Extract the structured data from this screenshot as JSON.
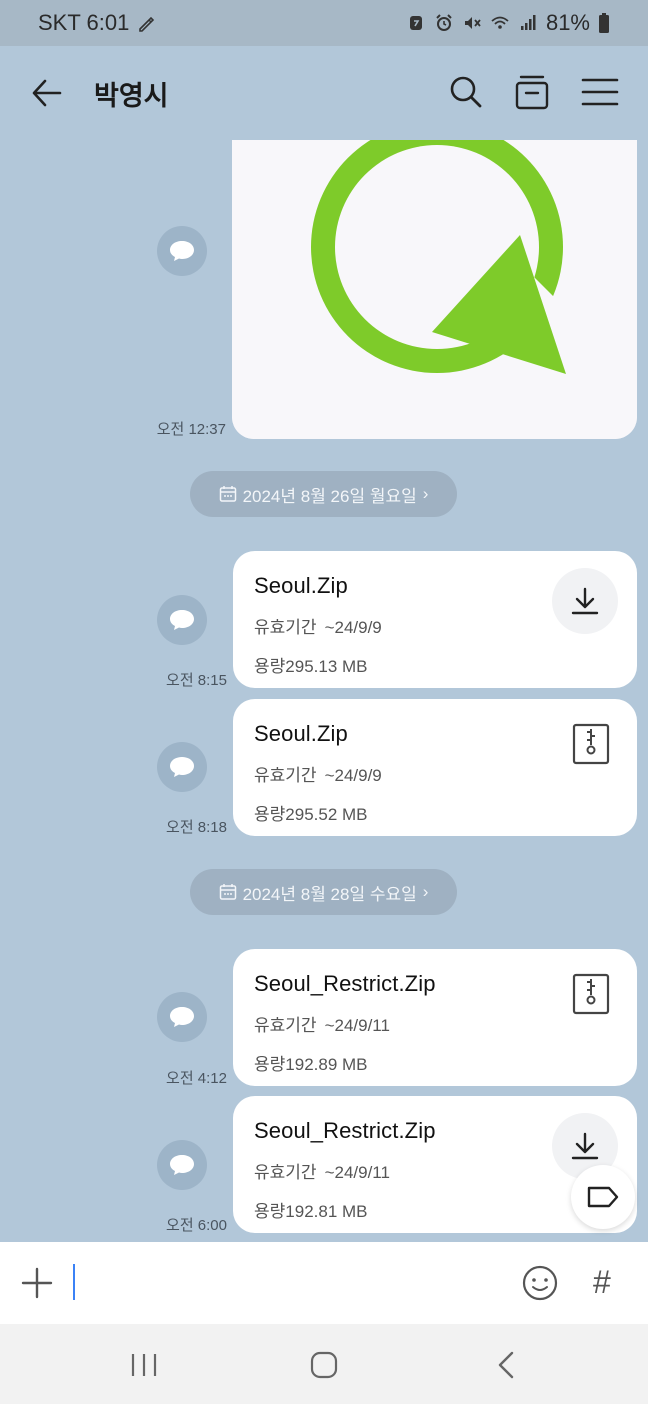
{
  "status_bar": {
    "carrier_time": "SKT 6:01",
    "battery": "81%"
  },
  "header": {
    "title": "박영시"
  },
  "messages": [
    {
      "time": "오전 12:37"
    },
    {
      "date_label": "2024년 8월 26일 월요일"
    },
    {
      "file_name": "Seoul.Zip",
      "expiry_label": "유효기간",
      "expiry": "~24/9/9",
      "size_label": "용량",
      "size": "295.13 MB",
      "time": "오전 8:15",
      "action_icon": "download-icon"
    },
    {
      "file_name": "Seoul.Zip",
      "expiry_label": "유효기간",
      "expiry": "~24/9/9",
      "size_label": "용량",
      "size": "295.52 MB",
      "time": "오전 8:18",
      "action_icon": "zip-file-icon"
    },
    {
      "date_label": "2024년 8월 28일 수요일"
    },
    {
      "file_name": "Seoul_Restrict.Zip",
      "expiry_label": "유효기간",
      "expiry": "~24/9/11",
      "size_label": "용량",
      "size": "192.89 MB",
      "time": "오전 4:12",
      "action_icon": "zip-file-icon"
    },
    {
      "file_name": "Seoul_Restrict.Zip",
      "expiry_label": "유효기간",
      "expiry": "~24/9/11",
      "size_label": "용량",
      "size": "192.81 MB",
      "time": "오전 6:00",
      "action_icon": "download-icon"
    }
  ],
  "input": {
    "value": "",
    "placeholder": ""
  },
  "colors": {
    "chat_background": "#b2c7d9",
    "status_bar": "#a7b8c6",
    "logo_green": "#7ecb2a",
    "cursor": "#3b82f6"
  }
}
